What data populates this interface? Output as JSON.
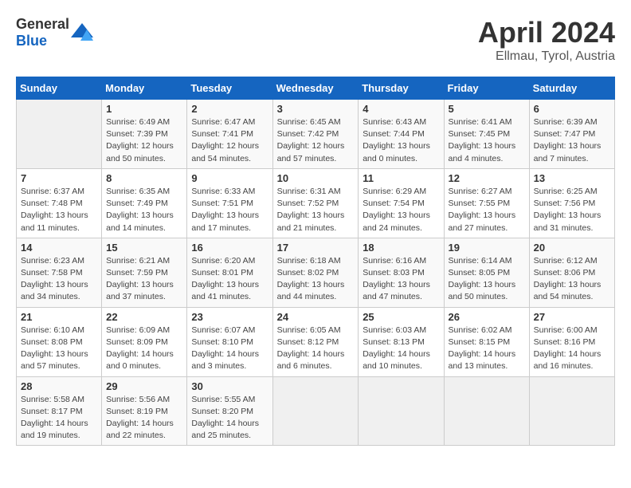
{
  "header": {
    "logo_general": "General",
    "logo_blue": "Blue",
    "month": "April 2024",
    "location": "Ellmau, Tyrol, Austria"
  },
  "weekdays": [
    "Sunday",
    "Monday",
    "Tuesday",
    "Wednesday",
    "Thursday",
    "Friday",
    "Saturday"
  ],
  "weeks": [
    [
      {
        "day": "",
        "info": ""
      },
      {
        "day": "1",
        "info": "Sunrise: 6:49 AM\nSunset: 7:39 PM\nDaylight: 12 hours\nand 50 minutes."
      },
      {
        "day": "2",
        "info": "Sunrise: 6:47 AM\nSunset: 7:41 PM\nDaylight: 12 hours\nand 54 minutes."
      },
      {
        "day": "3",
        "info": "Sunrise: 6:45 AM\nSunset: 7:42 PM\nDaylight: 12 hours\nand 57 minutes."
      },
      {
        "day": "4",
        "info": "Sunrise: 6:43 AM\nSunset: 7:44 PM\nDaylight: 13 hours\nand 0 minutes."
      },
      {
        "day": "5",
        "info": "Sunrise: 6:41 AM\nSunset: 7:45 PM\nDaylight: 13 hours\nand 4 minutes."
      },
      {
        "day": "6",
        "info": "Sunrise: 6:39 AM\nSunset: 7:47 PM\nDaylight: 13 hours\nand 7 minutes."
      }
    ],
    [
      {
        "day": "7",
        "info": "Sunrise: 6:37 AM\nSunset: 7:48 PM\nDaylight: 13 hours\nand 11 minutes."
      },
      {
        "day": "8",
        "info": "Sunrise: 6:35 AM\nSunset: 7:49 PM\nDaylight: 13 hours\nand 14 minutes."
      },
      {
        "day": "9",
        "info": "Sunrise: 6:33 AM\nSunset: 7:51 PM\nDaylight: 13 hours\nand 17 minutes."
      },
      {
        "day": "10",
        "info": "Sunrise: 6:31 AM\nSunset: 7:52 PM\nDaylight: 13 hours\nand 21 minutes."
      },
      {
        "day": "11",
        "info": "Sunrise: 6:29 AM\nSunset: 7:54 PM\nDaylight: 13 hours\nand 24 minutes."
      },
      {
        "day": "12",
        "info": "Sunrise: 6:27 AM\nSunset: 7:55 PM\nDaylight: 13 hours\nand 27 minutes."
      },
      {
        "day": "13",
        "info": "Sunrise: 6:25 AM\nSunset: 7:56 PM\nDaylight: 13 hours\nand 31 minutes."
      }
    ],
    [
      {
        "day": "14",
        "info": "Sunrise: 6:23 AM\nSunset: 7:58 PM\nDaylight: 13 hours\nand 34 minutes."
      },
      {
        "day": "15",
        "info": "Sunrise: 6:21 AM\nSunset: 7:59 PM\nDaylight: 13 hours\nand 37 minutes."
      },
      {
        "day": "16",
        "info": "Sunrise: 6:20 AM\nSunset: 8:01 PM\nDaylight: 13 hours\nand 41 minutes."
      },
      {
        "day": "17",
        "info": "Sunrise: 6:18 AM\nSunset: 8:02 PM\nDaylight: 13 hours\nand 44 minutes."
      },
      {
        "day": "18",
        "info": "Sunrise: 6:16 AM\nSunset: 8:03 PM\nDaylight: 13 hours\nand 47 minutes."
      },
      {
        "day": "19",
        "info": "Sunrise: 6:14 AM\nSunset: 8:05 PM\nDaylight: 13 hours\nand 50 minutes."
      },
      {
        "day": "20",
        "info": "Sunrise: 6:12 AM\nSunset: 8:06 PM\nDaylight: 13 hours\nand 54 minutes."
      }
    ],
    [
      {
        "day": "21",
        "info": "Sunrise: 6:10 AM\nSunset: 8:08 PM\nDaylight: 13 hours\nand 57 minutes."
      },
      {
        "day": "22",
        "info": "Sunrise: 6:09 AM\nSunset: 8:09 PM\nDaylight: 14 hours\nand 0 minutes."
      },
      {
        "day": "23",
        "info": "Sunrise: 6:07 AM\nSunset: 8:10 PM\nDaylight: 14 hours\nand 3 minutes."
      },
      {
        "day": "24",
        "info": "Sunrise: 6:05 AM\nSunset: 8:12 PM\nDaylight: 14 hours\nand 6 minutes."
      },
      {
        "day": "25",
        "info": "Sunrise: 6:03 AM\nSunset: 8:13 PM\nDaylight: 14 hours\nand 10 minutes."
      },
      {
        "day": "26",
        "info": "Sunrise: 6:02 AM\nSunset: 8:15 PM\nDaylight: 14 hours\nand 13 minutes."
      },
      {
        "day": "27",
        "info": "Sunrise: 6:00 AM\nSunset: 8:16 PM\nDaylight: 14 hours\nand 16 minutes."
      }
    ],
    [
      {
        "day": "28",
        "info": "Sunrise: 5:58 AM\nSunset: 8:17 PM\nDaylight: 14 hours\nand 19 minutes."
      },
      {
        "day": "29",
        "info": "Sunrise: 5:56 AM\nSunset: 8:19 PM\nDaylight: 14 hours\nand 22 minutes."
      },
      {
        "day": "30",
        "info": "Sunrise: 5:55 AM\nSunset: 8:20 PM\nDaylight: 14 hours\nand 25 minutes."
      },
      {
        "day": "",
        "info": ""
      },
      {
        "day": "",
        "info": ""
      },
      {
        "day": "",
        "info": ""
      },
      {
        "day": "",
        "info": ""
      }
    ]
  ]
}
